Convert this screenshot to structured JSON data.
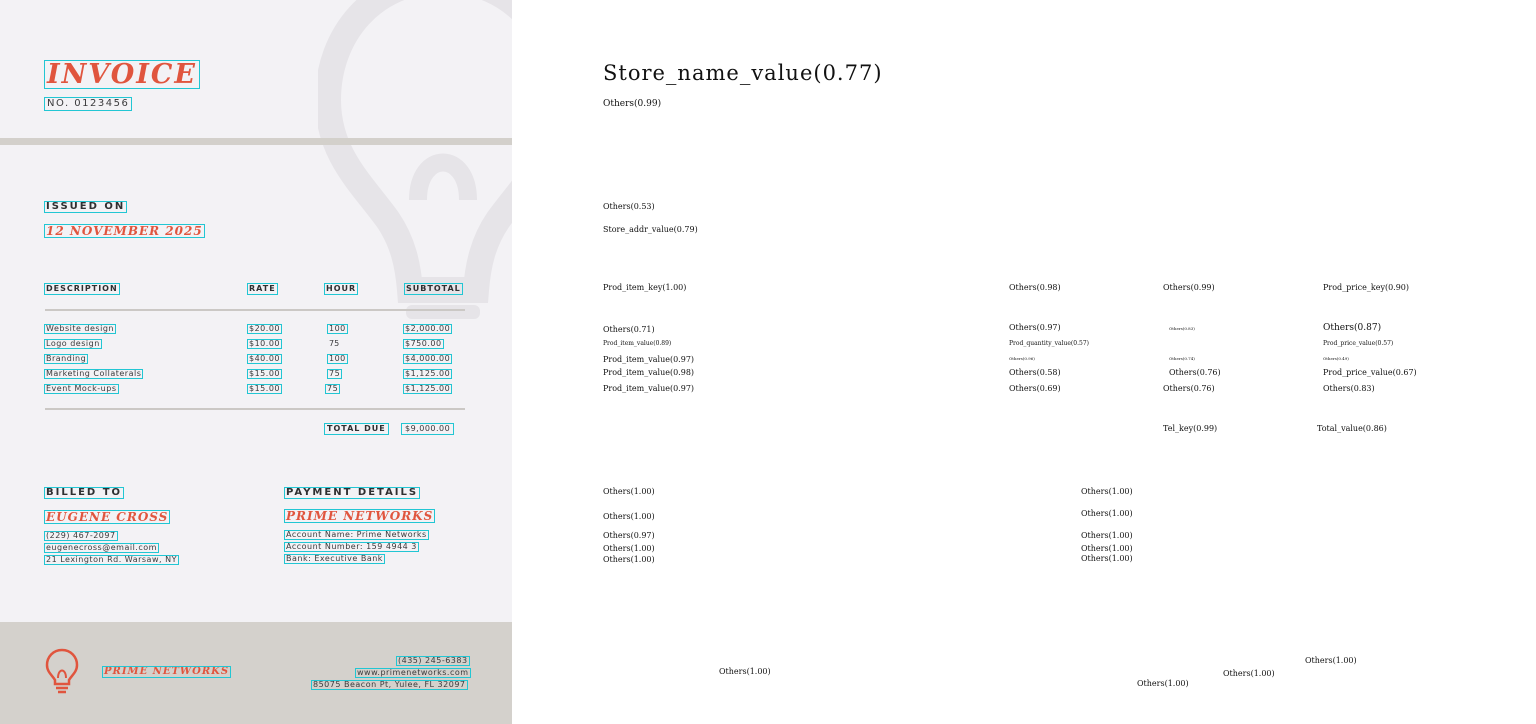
{
  "invoice": {
    "title": "INVOICE",
    "number": "NO. 0123456",
    "issued_label": "ISSUED ON",
    "issued_date": "12 NOVEMBER 2025",
    "columns": [
      "DESCRIPTION",
      "RATE",
      "HOUR",
      "SUBTOTAL"
    ],
    "rows": [
      {
        "description": "Website design",
        "rate": "$20.00",
        "hour": "100",
        "subtotal": "$2,000.00"
      },
      {
        "description": "Logo design",
        "rate": "$10.00",
        "hour": "75",
        "subtotal": "$750.00"
      },
      {
        "description": "Branding",
        "rate": "$40.00",
        "hour": "100",
        "subtotal": "$4,000.00"
      },
      {
        "description": "Marketing Collaterals",
        "rate": "$15.00",
        "hour": "75",
        "subtotal": "$1,125.00"
      },
      {
        "description": "Event Mock-ups",
        "rate": "$15.00",
        "hour": "75",
        "subtotal": "$1,125.00"
      }
    ],
    "total_label": "TOTAL DUE",
    "total_value": "$9,000.00",
    "billed_label": "BILLED TO",
    "billed_name": "EUGENE CROSS",
    "billed_phone": "(229) 467-2097",
    "billed_email": "eugenecross@email.com",
    "billed_address": "21 Lexington Rd. Warsaw, NY",
    "payment_label": "PAYMENT DETAILS",
    "payment_company": "PRIME NETWORKS",
    "account_name": "Account Name: Prime Networks",
    "account_number": "Account Number: 159 4944 3",
    "bank": "Bank: Executive Bank",
    "footer_company": "PRIME NETWORKS",
    "footer_phone": "(435) 245-6383",
    "footer_web": "www.primenetworks.com",
    "footer_address": "85075 Beacon Pt, Yulee, FL 32097",
    "accent_color": "#e0553e",
    "box_color": "#22c6d3"
  },
  "labels": {
    "store_name": "Store_name_value(0.77)",
    "l_0_99_a": "Others(0.99)",
    "l_0_53": "Others(0.53)",
    "store_addr": "Store_addr_value(0.79)",
    "prod_item_key": "Prod_item_key(1.00)",
    "l_0_98_a": "Others(0.98)",
    "l_0_99_b": "Others(0.99)",
    "prod_price_key": "Prod_price_key(0.90)",
    "l_0_71": "Others(0.71)",
    "l_0_97_a": "Others(0.97)",
    "l_0_83_tiny": "Others(0.83)",
    "l_0_87": "Others(0.87)",
    "prod_item_value_089": "Prod_item_value(0.89)",
    "prod_qty_value": "Prod_quantity_value(0.57)",
    "prod_price_value_057": "Prod_price_value(0.57)",
    "prod_item_value_097_a": "Prod_item_value(0.97)",
    "l_0_96_tiny": "Others(0.96)",
    "l_0_74_tiny": "Others(0.74)",
    "l_0_49_tiny": "Others(0.49)",
    "prod_item_value_098": "Prod_item_value(0.98)",
    "l_0_58": "Others(0.58)",
    "l_0_76_a": "Others(0.76)",
    "prod_price_value_067": "Prod_price_value(0.67)",
    "prod_item_value_097_b": "Prod_item_value(0.97)",
    "l_0_69": "Others(0.69)",
    "l_0_76_b": "Others(0.76)",
    "l_0_83": "Others(0.83)",
    "tel_key": "Tel_key(0.99)",
    "total_value": "Total_value(0.86)",
    "l_1_00_a": "Others(1.00)",
    "l_1_00_b": "Others(1.00)",
    "l_1_00_c": "Others(1.00)",
    "l_1_00_d": "Others(1.00)",
    "l_0_97_b": "Others(0.97)",
    "l_1_00_e": "Others(1.00)",
    "l_1_00_f": "Others(1.00)",
    "l_1_00_g": "Others(1.00)",
    "l_1_00_h": "Others(1.00)",
    "l_1_00_i": "Others(1.00)",
    "l_1_00_j": "Others(1.00)",
    "l_1_00_k": "Others(1.00)",
    "l_1_00_l": "Others(1.00)",
    "l_1_00_m": "Others(1.00)",
    "l_1_00_n": "Others(1.00)"
  }
}
